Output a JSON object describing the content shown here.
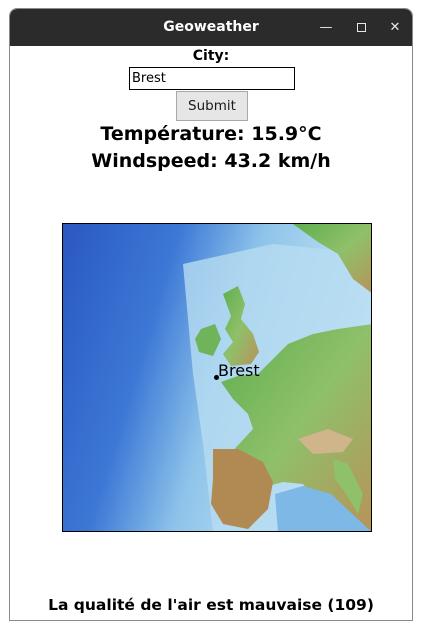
{
  "window": {
    "title": "Geoweather"
  },
  "form": {
    "city_label": "City:",
    "city_value": "Brest",
    "submit_label": "Submit"
  },
  "weather": {
    "temperature_text": "Température: 15.9°C",
    "windspeed_text": "Windspeed: 43.2 km/h"
  },
  "map": {
    "marker_label": "Brest",
    "icons": [
      "minimize-icon",
      "maximize-icon",
      "close-icon"
    ]
  },
  "air_quality": {
    "text": "La qualité de l'air est mauvaise (109)"
  },
  "colors": {
    "titlebar": "#2b2b2b",
    "ocean_deep": "#2f63c8",
    "ocean_shallow": "#bfe0f2",
    "land_green": "#3e9a3e",
    "land_high": "#b48a4a"
  }
}
